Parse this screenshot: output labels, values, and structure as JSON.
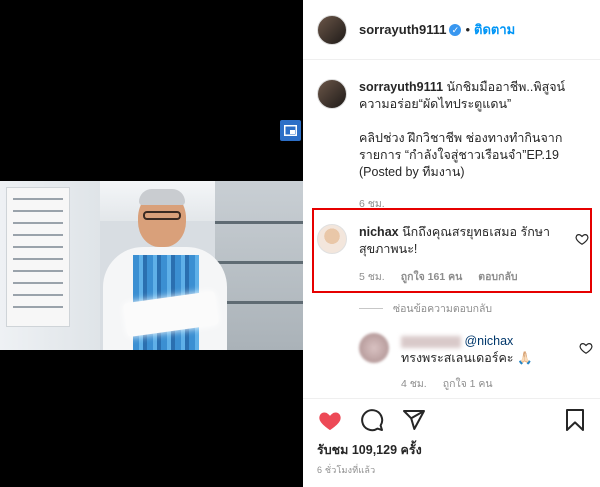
{
  "header": {
    "username": "sorrayuth9111",
    "verified_glyph": "✓",
    "follow_label": "ติดตาม"
  },
  "caption": {
    "username": "sorrayuth9111",
    "line1": "นักชิมมืออาชีพ..พิสูจน์ความอร่อย“ผัดไทประตูแดน”",
    "para2": "คลิปช่วง ฝึกวิชาชีพ ช่องทางทำกินจากรายการ “กำลังใจสู่ชาวเรือนจำ”EP.19 (Posted by ทีมงาน)",
    "time": "6 ชม."
  },
  "comment": {
    "username": "nichax",
    "text": "นึกถึงคุณสรยุทธเสมอ รักษาสุขภาพนะ!",
    "time": "5 ชม.",
    "likes": "ถูกใจ 161 คน",
    "reply_label": "ตอบกลับ"
  },
  "replies_toggle": "ซ่อนข้อความตอบกลับ",
  "reply": {
    "mention": "@nichax",
    "text": "ทรงพระสเลนเดอร์คะ 🙏🏻",
    "time": "4 ชม.",
    "likes": "ถูกใจ 1 คน"
  },
  "views": "รับชม 109,129 ครั้ง",
  "posted": "6 ชั่วโมงที่แล้ว",
  "icons": {
    "like": "heart-filled-icon",
    "comment": "comment-icon",
    "share": "paper-plane-icon",
    "save": "bookmark-icon",
    "comment_like": "heart-outline-icon",
    "media": "picture-in-picture-icon"
  },
  "colors": {
    "accent": "#0095f6",
    "like_red": "#ed4956",
    "highlight_box": "#e60000",
    "verified": "#3897f0"
  }
}
